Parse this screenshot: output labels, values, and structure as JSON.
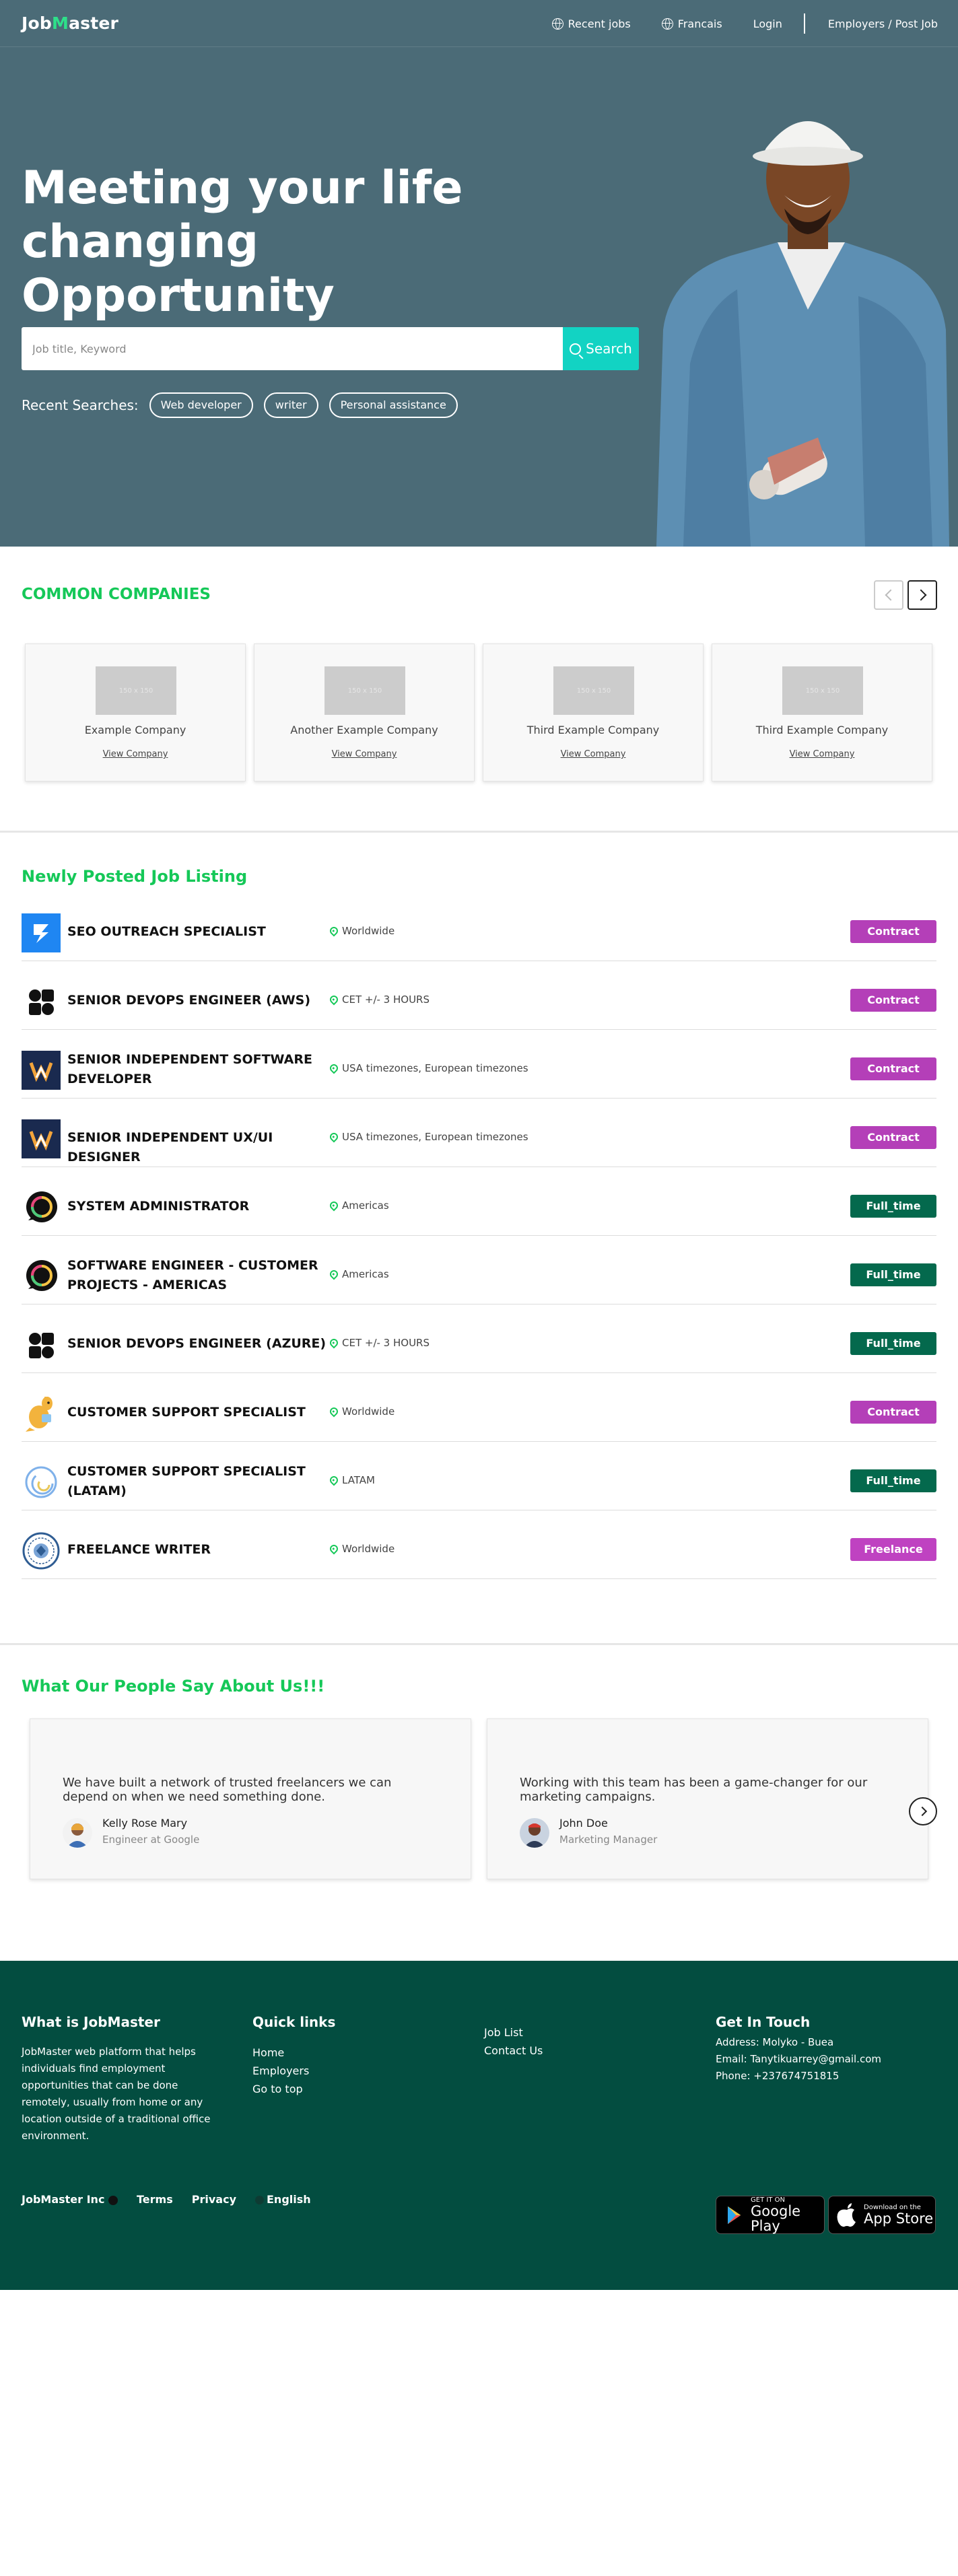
{
  "colors": {
    "hero_bg": "#4b6b77",
    "accent_green": "#15c858",
    "search_teal": "#12d3c3",
    "contract": "#b43fb8",
    "full_time": "#04694d",
    "freelance": "#bf42c1",
    "footer_bg": "#034d40"
  },
  "nav": {
    "logo_a": "Job",
    "logo_b": "M",
    "logo_c": "aster",
    "recent_jobs": "Recent jobs",
    "language": "Francais",
    "login": "Login",
    "employers": "Employers / Post Job"
  },
  "hero": {
    "title_line1": "Meeting your life changing",
    "title_line2": "Opportunity",
    "search_placeholder": "Job title, Keyword",
    "search_button": "Search",
    "recent_label": "Recent Searches:",
    "recent": [
      "Web developer",
      "writer",
      "Personal assistance"
    ]
  },
  "companies": {
    "title": "COMMON COMPANIES",
    "placeholder": "150 x 150",
    "view_label": "View Company",
    "items": [
      "Example Company",
      "Another Example Company",
      "Third Example Company",
      "Third Example Company"
    ]
  },
  "jobs": {
    "title": "Newly Posted Job Listing",
    "items": [
      {
        "title": "SEO OUTREACH SPECIALIST",
        "location": "Worldwide",
        "type": "Contract",
        "logo": "blue-s-logo-icon"
      },
      {
        "title": "SENIOR DEVOPS ENGINEER (AWS)",
        "location": "CET +/- 3 HOURS",
        "type": "Contract",
        "logo": "shapes-logo-icon"
      },
      {
        "title": "SENIOR INDEPENDENT SOFTWARE DEVELOPER",
        "location": "USA timezones, European timezones",
        "type": "Contract",
        "logo": "w-logo-icon"
      },
      {
        "title": "SENIOR INDEPENDENT UX/UI DESIGNER",
        "location": "USA timezones, European timezones",
        "type": "Contract",
        "logo": "w-logo-icon"
      },
      {
        "title": "SYSTEM ADMINISTRATOR",
        "location": "Americas",
        "type": "Full_time",
        "logo": "chat-logo-icon"
      },
      {
        "title": "SOFTWARE ENGINEER - CUSTOMER PROJECTS - AMERICAS",
        "location": "Americas",
        "type": "Full_time",
        "logo": "chat-logo-icon"
      },
      {
        "title": "SENIOR DEVOPS ENGINEER (AZURE)",
        "location": "CET +/- 3 HOURS",
        "type": "Full_time",
        "logo": "shapes-logo-icon"
      },
      {
        "title": "CUSTOMER SUPPORT SPECIALIST",
        "location": "Worldwide",
        "type": "Contract",
        "logo": "kangaroo-logo-icon"
      },
      {
        "title": "CUSTOMER SUPPORT SPECIALIST (LATAM)",
        "location": "LATAM",
        "type": "Full_time",
        "logo": "swirl-logo-icon"
      },
      {
        "title": "FREELANCE WRITER",
        "location": "Worldwide",
        "type": "Freelance",
        "logo": "seal-logo-icon"
      }
    ]
  },
  "testimonials": {
    "title": "What Our People Say About Us!!!",
    "items": [
      {
        "quote": "We have built a network of trusted freelancers we can depend on when we need something done.",
        "name": "Kelly Rose Mary",
        "role": "Engineer at Google"
      },
      {
        "quote": "Working with this team has been a game-changer for our marketing campaigns.",
        "name": "John Doe",
        "role": "Marketing Manager"
      }
    ]
  },
  "footer": {
    "about_title": "What is JobMaster",
    "about_text": "JobMaster web platform that helps individuals find employment opportunities that can be done remotely, usually from home or any location outside of a traditional office environment.",
    "quick_title": "Quick links",
    "quick_links": [
      "Home",
      "Employers",
      "Go to top"
    ],
    "more_links": [
      "Job List",
      "Contact Us"
    ],
    "contact_title": "Get In Touch",
    "address": "Address: Molyko - Buea",
    "email": "Email: Tanytikuarrey@gmail.com",
    "phone": "Phone: +237674751815",
    "company": "JobMaster Inc",
    "terms": "Terms",
    "privacy": "Privacy",
    "lang": "English",
    "gplay_small": "GET IT ON",
    "gplay_big": "Google Play",
    "appstore_small": "Download on the",
    "appstore_big": "App Store"
  }
}
